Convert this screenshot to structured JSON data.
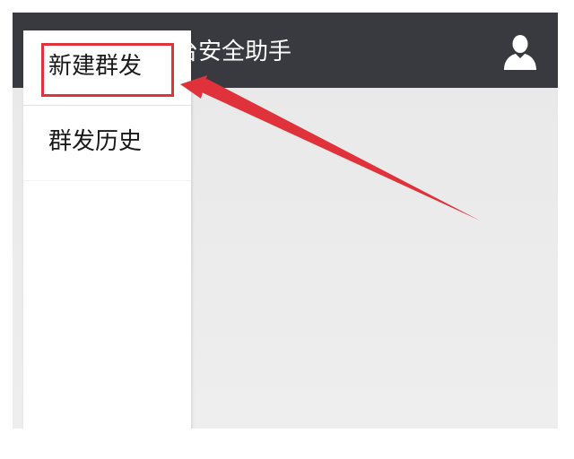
{
  "header": {
    "title": "台安全助手",
    "profile_icon": "user-icon",
    "background_color": "#393a3f"
  },
  "menu": {
    "items": [
      {
        "label": "新建群发"
      },
      {
        "label": "群发历史"
      }
    ]
  },
  "annotation": {
    "highlight_color": "#e0323a",
    "arrow_color": "#e0323a"
  }
}
